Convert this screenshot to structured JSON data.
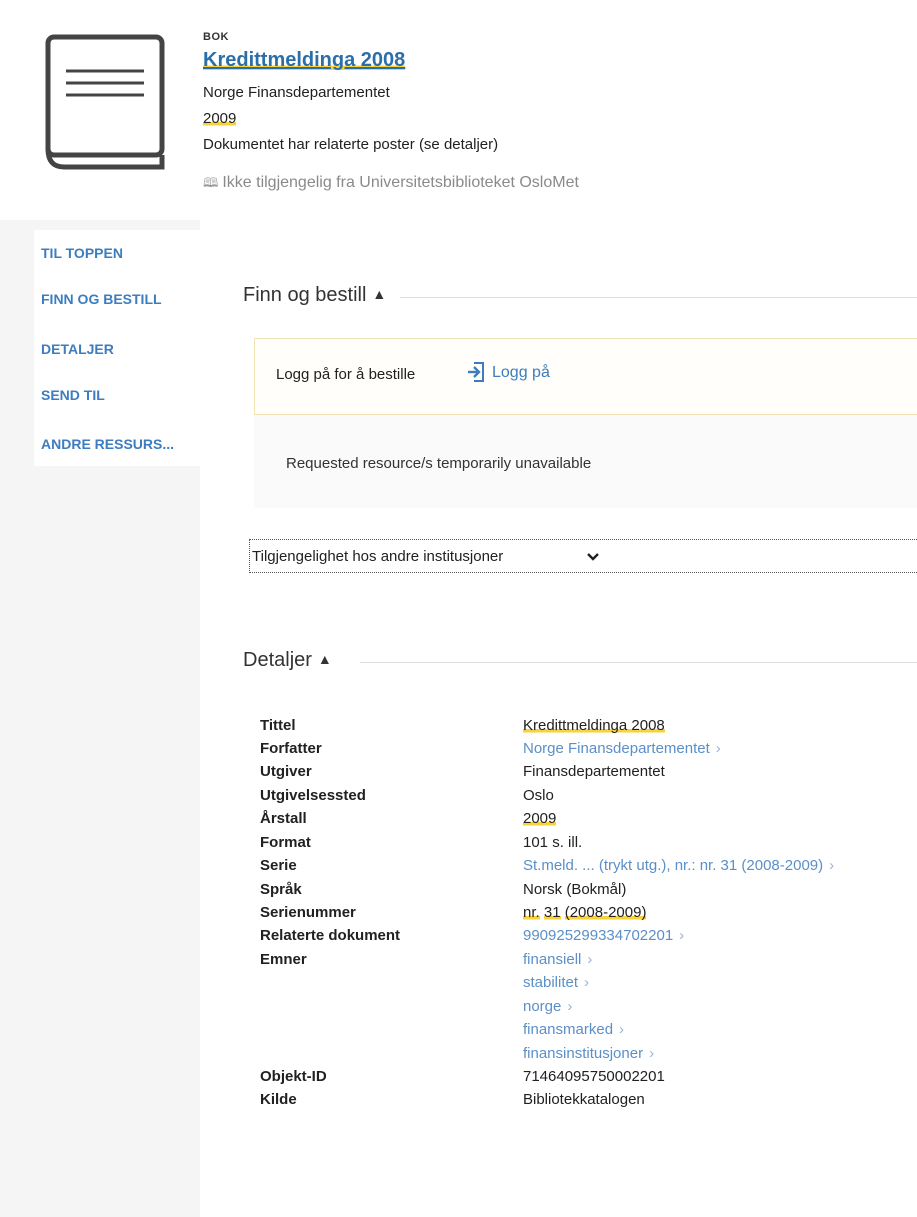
{
  "record": {
    "type": "BOK",
    "title": "Kredittmeldinga 2008",
    "author": "Norge Finansdepartementet",
    "year": "2009",
    "related_note": "Dokumentet har relaterte poster (se detaljer)",
    "availability": "Ikke tilgjengelig fra Universitetsbiblioteket OsloMet"
  },
  "nav": {
    "items": [
      "TIL TOPPEN",
      "FINN OG BESTILL",
      "DETALJER",
      "SEND TIL",
      "ANDRE RESSURS..."
    ]
  },
  "finn": {
    "title": "Finn og bestill",
    "login_prompt": "Logg på for å bestille",
    "login_link": "Logg på",
    "unavailable": "Requested resource/s temporarily unavailable",
    "other_institutions": "Tilgjengelighet hos andre institusjoner"
  },
  "details": {
    "title": "Detaljer",
    "labels": {
      "title": "Tittel",
      "author": "Forfatter",
      "publisher": "Utgiver",
      "place": "Utgivelsessted",
      "year": "Årstall",
      "format": "Format",
      "series": "Serie",
      "language": "Språk",
      "series_number": "Serienummer",
      "related": "Relaterte dokument",
      "subjects": "Emner",
      "object_id": "Objekt-ID",
      "source": "Kilde"
    },
    "values": {
      "title": "Kredittmeldinga 2008",
      "author": "Norge Finansdepartementet",
      "publisher": "Finansdepartementet",
      "place": "Oslo",
      "year": "2009",
      "format": "101 s. ill.",
      "series": "St.meld. ... (trykt utg.), nr.: nr. 31 (2008-2009)",
      "language": "Norsk (Bokmål)",
      "series_number_prefix": "nr.",
      "series_number_num": "31",
      "series_number_years": "(2008-2009)",
      "related": "990925299334702201",
      "subjects": [
        "finansiell",
        "stabilitet",
        "norge",
        "finansmarked",
        "finansinstitusjoner"
      ],
      "object_id": "71464095750002201",
      "source": "Bibliotekkatalogen"
    }
  }
}
